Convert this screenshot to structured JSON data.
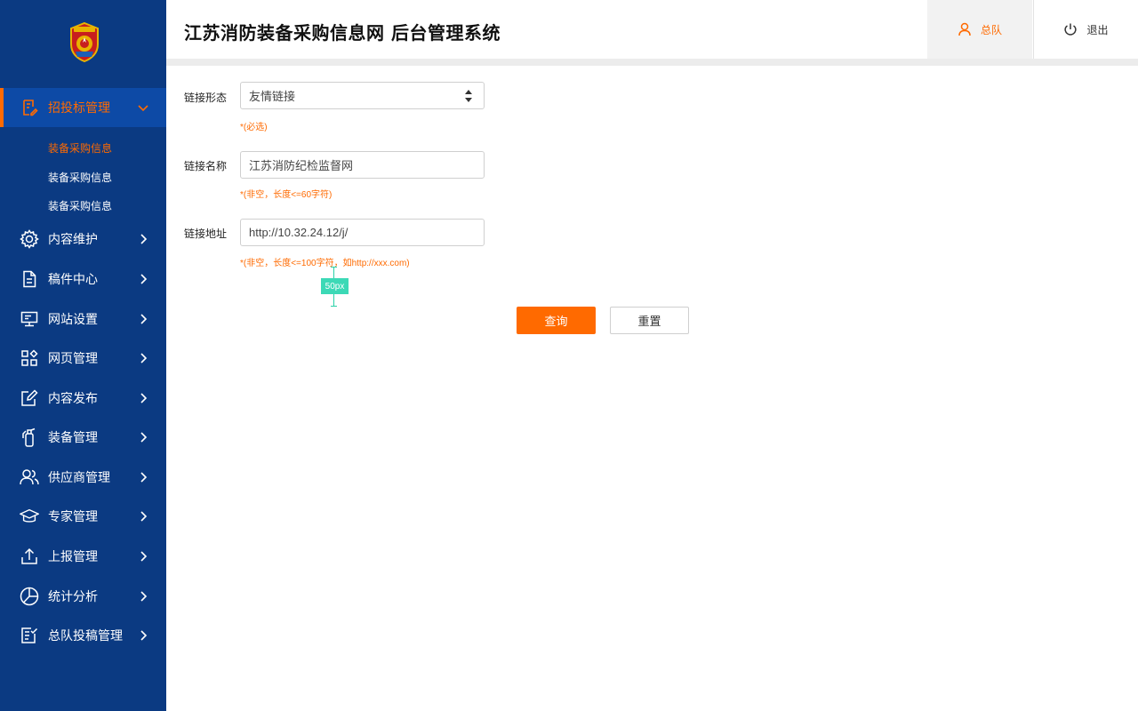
{
  "app": {
    "title": "江苏消防装备采购信息网  后台管理系统",
    "accent_color": "#ff6a00",
    "sidebar_color": "#0b3a82"
  },
  "header": {
    "user_label": "总队",
    "logout_label": "退出"
  },
  "sidebar": {
    "active_menu": {
      "label": "招投标管理",
      "icon": "document-edit-icon",
      "subitems": [
        {
          "label": "装备采购信息",
          "active": true
        },
        {
          "label": "装备采购信息",
          "active": false
        },
        {
          "label": "装备采购信息",
          "active": false
        }
      ]
    },
    "items": [
      {
        "label": "内容维护",
        "icon": "gear-icon"
      },
      {
        "label": "稿件中心",
        "icon": "file-icon"
      },
      {
        "label": "网站设置",
        "icon": "monitor-icon"
      },
      {
        "label": "网页管理",
        "icon": "grid-icon"
      },
      {
        "label": "内容发布",
        "icon": "edit-icon"
      },
      {
        "label": "装备管理",
        "icon": "extinguisher-icon"
      },
      {
        "label": "供应商管理",
        "icon": "users-icon"
      },
      {
        "label": "专家管理",
        "icon": "graduation-cap-icon"
      },
      {
        "label": "上报管理",
        "icon": "upload-icon"
      },
      {
        "label": "统计分析",
        "icon": "pie-chart-icon"
      },
      {
        "label": "总队投稿管理",
        "icon": "checklist-icon"
      }
    ]
  },
  "form": {
    "link_type": {
      "label": "链接形态",
      "value": "友情链接",
      "hint": "*(必选)"
    },
    "link_name": {
      "label": "链接名称",
      "value": "江苏消防纪检监督网",
      "hint": "*(非空，长度<=60字符)"
    },
    "link_url": {
      "label": "链接地址",
      "value": "http://10.32.24.12/j/",
      "hint": "*(非空，长度<=100字符，如http://xxx.com)"
    },
    "spacing_annotation": "50px",
    "query_label": "查询",
    "reset_label": "重置"
  }
}
